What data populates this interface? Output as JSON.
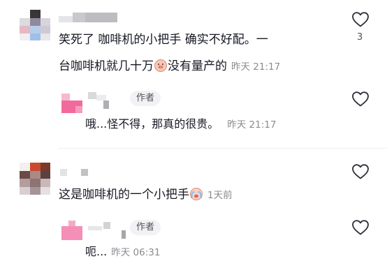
{
  "comments": [
    {
      "text_line1": "笑死了 咖啡机的小把手 确实不好配。一",
      "text_line2": "台咖啡机就几十万",
      "text_line2_after_emoji": "没有量产的",
      "time": "昨天 21:17",
      "likes": "3",
      "replies": [
        {
          "author_tag": "作者",
          "text": "哦...怪不得，那真的很贵。",
          "time": "昨天 21:17"
        }
      ]
    },
    {
      "text_line1": "这是咖啡机的一个小把手",
      "time": "1天前",
      "replies": [
        {
          "author_tag": "作者",
          "text": "呃...",
          "time": "昨天 06:31"
        }
      ]
    }
  ],
  "icons": {
    "like": "heart-outline-icon",
    "emoji_1": "pig-face-emoji",
    "emoji_2": "crying-face-emoji"
  }
}
